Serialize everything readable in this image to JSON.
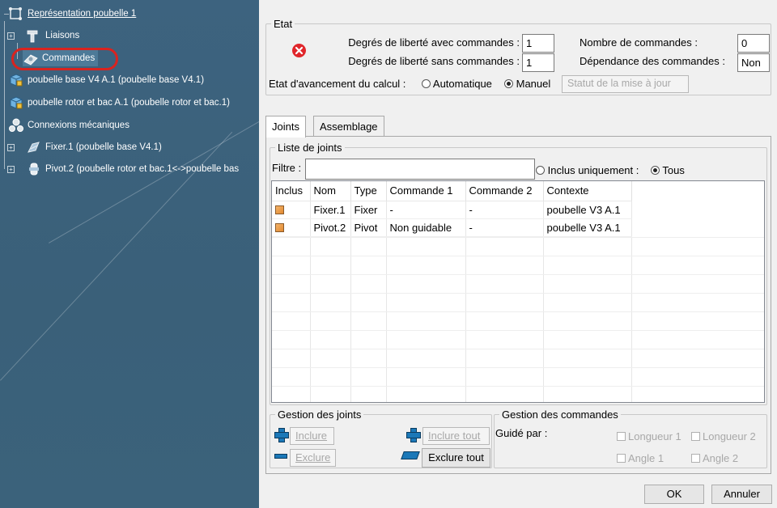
{
  "tree": {
    "root_label": "Représentation poubelle 1",
    "items": [
      {
        "label": "Liaisons"
      },
      {
        "label": "Commandes"
      },
      {
        "label": "poubelle base V4 A.1 (poubelle base V4.1)"
      },
      {
        "label": "poubelle rotor et bac A.1 (poubelle rotor et bac.1)"
      },
      {
        "label": "Connexions mécaniques"
      },
      {
        "label": "Fixer.1 (poubelle base V4.1)"
      },
      {
        "label": "Pivot.2 (poubelle rotor et bac.1<->poubelle bas"
      }
    ]
  },
  "etat": {
    "legend": "Etat",
    "dof_with_label": "Degrés de liberté avec commandes :",
    "dof_with_value": "1",
    "dof_without_label": "Degrés de liberté sans commandes :",
    "dof_without_value": "1",
    "nb_commands_label": "Nombre de commandes :",
    "nb_commands_value": "0",
    "dependance_label": "Dépendance des commandes :",
    "dependance_value": "Non",
    "calc_label": "Etat d'avancement du calcul :",
    "auto_label": "Automatique",
    "manual_label": "Manuel",
    "update_button": "Statut de la mise à jour"
  },
  "tabs": [
    {
      "label": "Joints"
    },
    {
      "label": "Assemblage"
    }
  ],
  "joints": {
    "legend": "Liste de joints",
    "filter_label": "Filtre :",
    "filter_value": "",
    "opt_included_label": "Inclus uniquement :",
    "opt_all_label": "Tous",
    "columns": [
      "Inclus",
      "Nom",
      "Type",
      "Commande 1",
      "Commande 2",
      "Contexte"
    ],
    "rows": [
      {
        "nom": "Fixer.1",
        "type": "Fixer",
        "cmd1": "-",
        "cmd2": "-",
        "contexte": "poubelle V3 A.1"
      },
      {
        "nom": "Pivot.2",
        "type": "Pivot",
        "cmd1": "Non guidable",
        "cmd2": "-",
        "contexte": "poubelle V3 A.1"
      }
    ]
  },
  "gestion_joints": {
    "legend": "Gestion des joints",
    "include": "Inclure",
    "exclude": "Exclure",
    "include_all": "Inclure tout",
    "exclude_all": "Exclure tout"
  },
  "gestion_commandes": {
    "legend": "Gestion des commandes",
    "guided_label": "Guidé par :",
    "longueur1": "Longueur 1",
    "longueur2": "Longueur 2",
    "angle1": "Angle 1",
    "angle2": "Angle 2"
  },
  "footer": {
    "ok": "OK",
    "cancel": "Annuler"
  },
  "colors": {
    "error_icon": "#e0262b",
    "highlight": "#d9231f",
    "tree_bg": "#3d637f"
  }
}
